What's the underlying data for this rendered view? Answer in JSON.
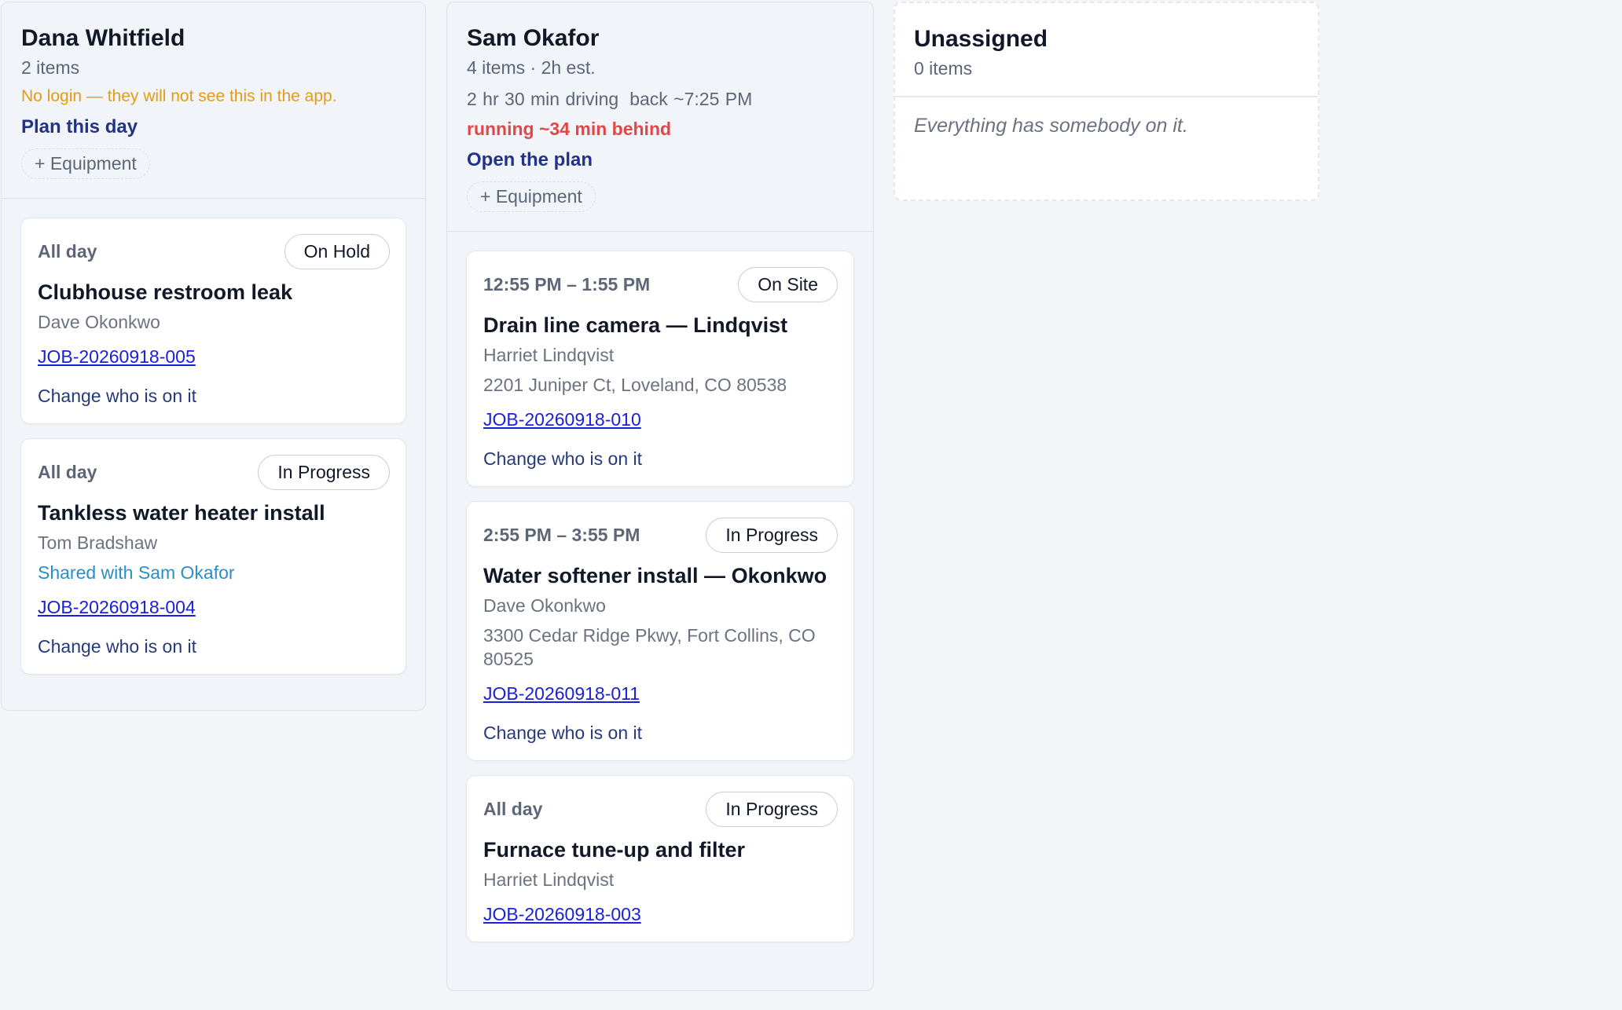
{
  "columns": {
    "dana": {
      "name": "Dana Whitfield",
      "count": "2 items",
      "warning": "No login — they will not see this in the app.",
      "plan_link": "Plan this day",
      "equipment_button": "+ Equipment",
      "cards": [
        {
          "when": "All day",
          "status": "On Hold",
          "title": "Clubhouse restroom leak",
          "customer": "Dave Okonkwo",
          "job": "JOB-20260918-005",
          "change": "Change who is on it"
        },
        {
          "when": "All day",
          "status": "In Progress",
          "title": "Tankless water heater install",
          "customer": "Tom Bradshaw",
          "shared": "Shared with Sam Okafor",
          "job": "JOB-20260918-004",
          "change": "Change who is on it"
        }
      ]
    },
    "sam": {
      "name": "Sam Okafor",
      "count": "4 items · 2h est.",
      "driving": "2 hr 30 min driving",
      "back": "back ~7:25 PM",
      "behind": "running ~34 min behind",
      "plan_link": "Open the plan",
      "equipment_button": "+ Equipment",
      "cards": [
        {
          "when": "12:55 PM – 1:55 PM",
          "status": "On Site",
          "title": "Drain line camera — Lindqvist",
          "customer": "Harriet Lindqvist",
          "address": "2201 Juniper Ct, Loveland, CO 80538",
          "job": "JOB-20260918-010",
          "change": "Change who is on it"
        },
        {
          "when": "2:55 PM – 3:55 PM",
          "status": "In Progress",
          "title": "Water softener install — Okonkwo",
          "customer": "Dave Okonkwo",
          "address": "3300 Cedar Ridge Pkwy, Fort Collins, CO 80525",
          "job": "JOB-20260918-011",
          "change": "Change who is on it"
        },
        {
          "when": "All day",
          "status": "In Progress",
          "title": "Furnace tune-up and filter",
          "customer": "Harriet Lindqvist",
          "job": "JOB-20260918-003"
        }
      ]
    },
    "unassigned": {
      "name": "Unassigned",
      "count": "0 items",
      "empty": "Everything has somebody on it."
    }
  },
  "colors": {
    "page_bg": "#f3f5f9",
    "link": "#223385",
    "job_link": "#1a20d6",
    "warning": "#e59a16",
    "behind": "#e04848",
    "shared": "#2b8ec4"
  }
}
